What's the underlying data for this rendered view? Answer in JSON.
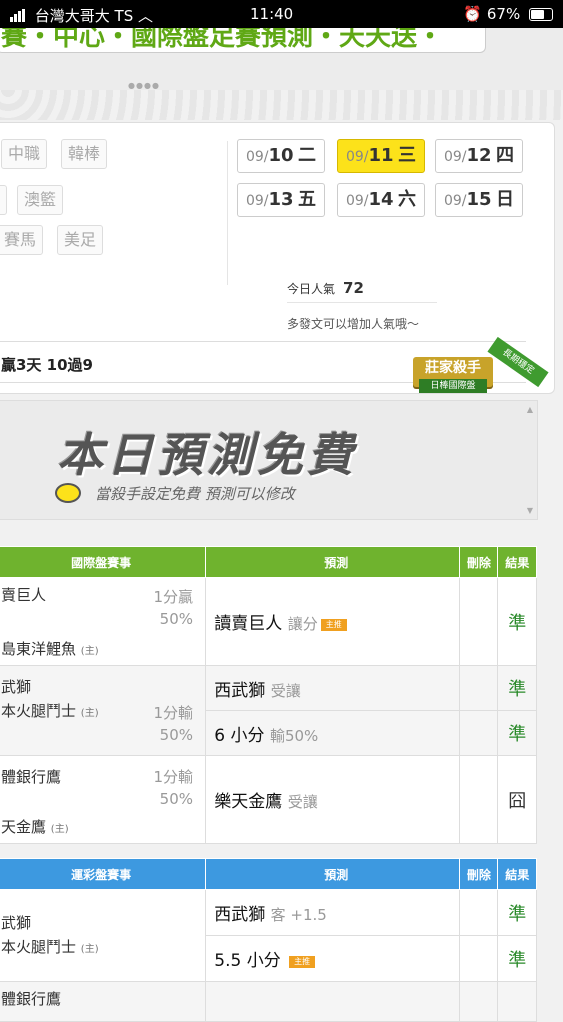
{
  "status": {
    "carrier": "台灣大哥大 TS",
    "time": "11:40",
    "battery": "67%"
  },
  "banner": {
    "title": "賽・中心・國際盤足賽預測・天天送・",
    "dots": "●●●●"
  },
  "leagues": [
    "中職",
    "韓棒",
    "澳籃",
    "賽馬",
    "美足"
  ],
  "dates": [
    {
      "md": "09/",
      "d": "10",
      "w": "二"
    },
    {
      "md": "09/",
      "d": "11",
      "w": "三"
    },
    {
      "md": "09/",
      "d": "12",
      "w": "四"
    },
    {
      "md": "09/",
      "d": "13",
      "w": "五"
    },
    {
      "md": "09/",
      "d": "14",
      "w": "六"
    },
    {
      "md": "09/",
      "d": "15",
      "w": "日"
    }
  ],
  "popularity": {
    "label": "今日人氣",
    "value": "72"
  },
  "hint": "多發文可以增加人氣哦～",
  "record": "贏3天 10過9",
  "badge": {
    "main": "莊家殺手",
    "sub": "日棒國際盤",
    "ribbon": "長期穩定"
  },
  "ad": {
    "title": "本日預測免費",
    "subtitle": "當殺手設定免費 預測可以修改"
  },
  "intl_table": {
    "headers": [
      "國際盤賽事",
      "預測",
      "刪除",
      "結果"
    ],
    "rows": [
      {
        "home": "賣巨人",
        "away": "島東洋鯉魚",
        "host": "(主)",
        "spread_a": "1分贏",
        "spread_b": "50%",
        "predictions": [
          {
            "main": "讀賣巨人",
            "detail": "讓分",
            "tag": "主推",
            "result": "準"
          }
        ]
      },
      {
        "home": "武獅",
        "away": "本火腿鬥士",
        "host": "(主)",
        "spread_a": "1分輸",
        "spread_b": "50%",
        "predictions": [
          {
            "main": "西武獅",
            "detail": "受讓",
            "tag": "",
            "result": "準"
          },
          {
            "main": "6 小分",
            "detail": "輸50%",
            "tag": "",
            "result": "準"
          }
        ]
      },
      {
        "home": "體銀行鷹",
        "away": "天金鷹",
        "host": "(主)",
        "spread_a": "1分輸",
        "spread_b": "50%",
        "predictions": [
          {
            "main": "樂天金鷹",
            "detail": "受讓",
            "tag": "",
            "result": "囧"
          }
        ]
      }
    ]
  },
  "lottery_table": {
    "headers": [
      "運彩盤賽事",
      "預測",
      "刪除",
      "結果"
    ],
    "rows": [
      {
        "home": "武獅",
        "away": "本火腿鬥士",
        "host": "(主)",
        "predictions": [
          {
            "main": "西武獅",
            "detail": "客 +1.5",
            "tag": "",
            "result": "準"
          },
          {
            "main": "5.5 小分",
            "detail": "",
            "tag": "主推",
            "result": "準"
          }
        ]
      },
      {
        "home": "體銀行鷹",
        "away": "",
        "host": "",
        "predictions": [
          {
            "main": "",
            "detail": "",
            "tag": "",
            "result": ""
          }
        ]
      }
    ]
  }
}
